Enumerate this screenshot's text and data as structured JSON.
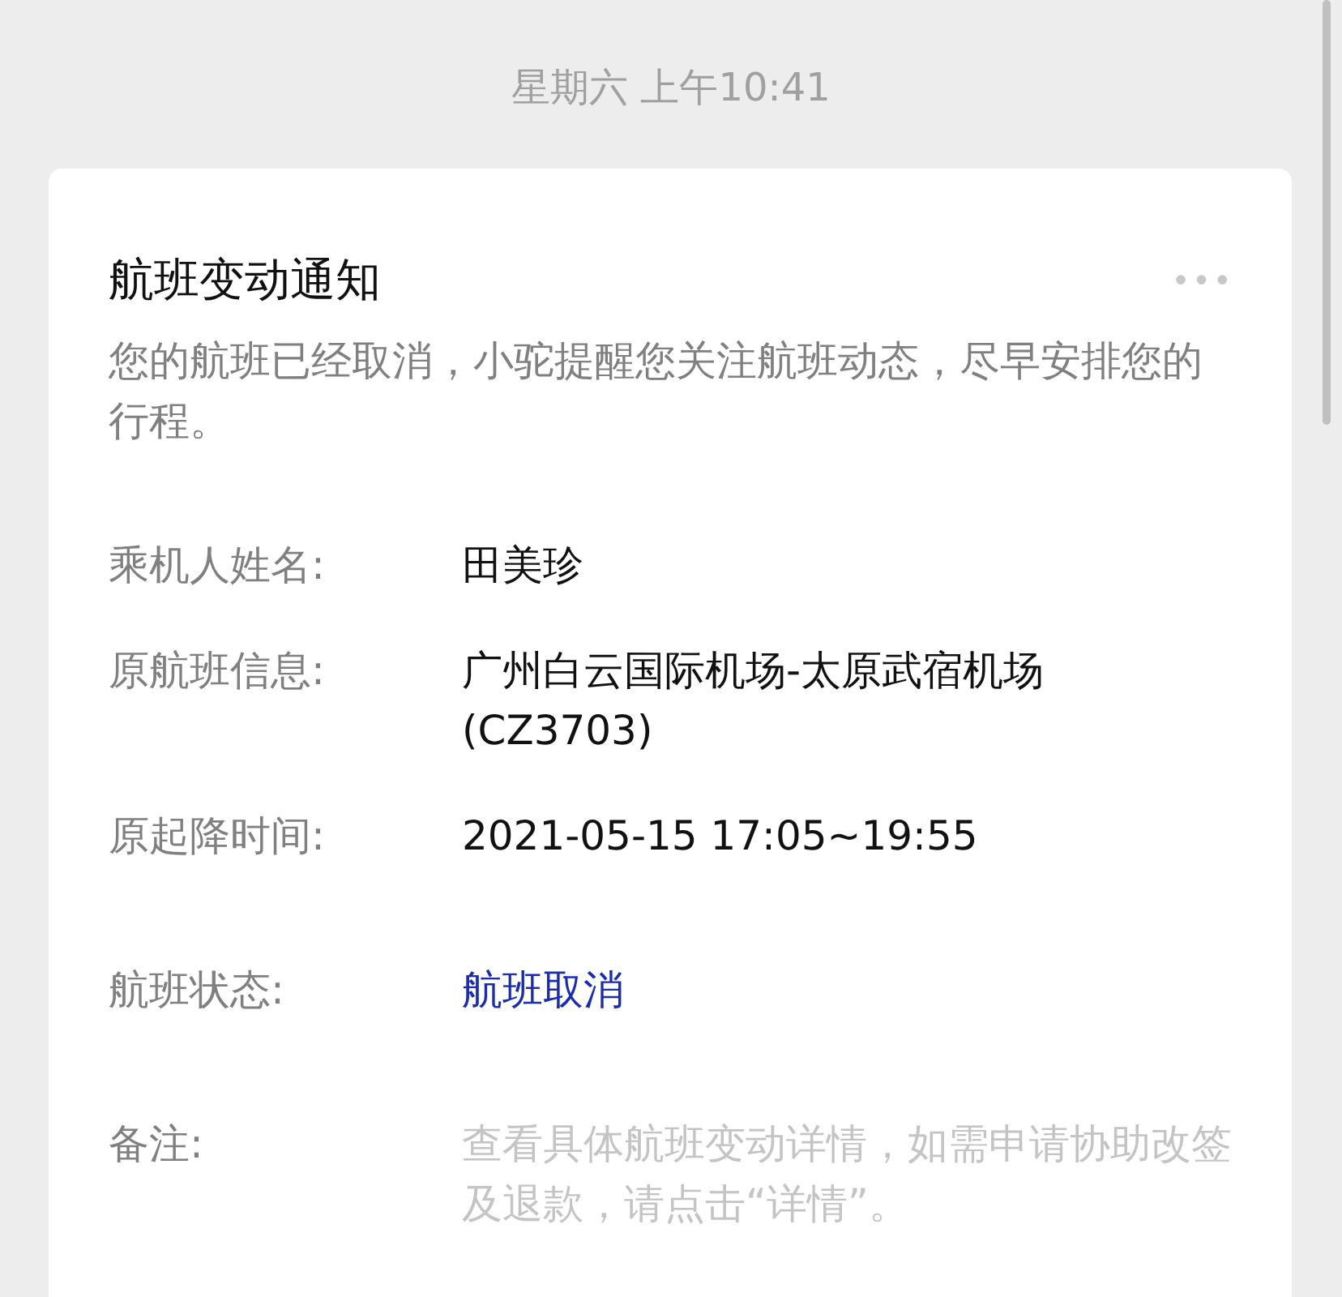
{
  "timestamp": "星期六 上午10:41",
  "card": {
    "title": "航班变动通知",
    "more_icon": "•••",
    "intro": "您的航班已经取消，小驼提醒您关注航班动态，尽早安排您的行程。",
    "fields": [
      {
        "label": "乘机人姓名:",
        "value": "田美珍",
        "kind": "plain"
      },
      {
        "label": "原航班信息:",
        "value": "广州白云国际机场-太原武宿机场(CZ3703)",
        "kind": "plain"
      },
      {
        "label": "原起降时间:",
        "value": "2021-05-15 17:05~19:55",
        "kind": "plain"
      },
      {
        "label": "航班状态:",
        "value": "航班取消",
        "kind": "status"
      },
      {
        "label": "备注:",
        "value": "查看具体航班变动详情，如需申请协助改签及退款，请点击“详情”。",
        "kind": "note"
      }
    ]
  }
}
